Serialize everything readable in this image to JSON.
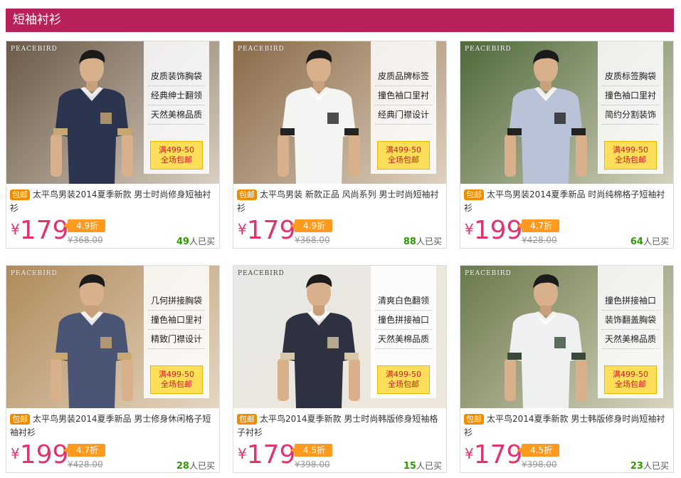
{
  "section_title": "短袖衬衫",
  "brand": "PEACEBIRD",
  "products": [
    {
      "features": [
        "皮质装饰胸袋",
        "经典绅士翻领",
        "天然美棉品质"
      ],
      "promo_line1": "满499-50",
      "promo_line2": "全场包邮",
      "free_ship": "包邮",
      "title": "太平鸟男装2014夏季新款 男士时尚修身短袖衬衫",
      "currency": "¥",
      "price": "179",
      "discount": "4.9折",
      "original_price": "¥368.00",
      "sold_count": "49",
      "sold_suffix": "人已买",
      "colors": {
        "bg": "#6b5a4a",
        "shirt": "#2b3550",
        "accent": "#c9a770"
      }
    },
    {
      "features": [
        "皮质品牌标签",
        "撞色袖口里衬",
        "经典门襟设计"
      ],
      "promo_line1": "满499-50",
      "promo_line2": "全场包邮",
      "free_ship": "包邮",
      "title": "太平鸟男装 新款正品 风尚系列 男士时尚短袖衬衫",
      "currency": "¥",
      "price": "179",
      "discount": "4.9折",
      "original_price": "¥368.00",
      "sold_count": "88",
      "sold_suffix": "人已买",
      "colors": {
        "bg": "#8a6a48",
        "shirt": "#f4f4f2",
        "accent": "#222222"
      }
    },
    {
      "features": [
        "皮质标签胸袋",
        "撞色袖口里衬",
        "简约分割装饰"
      ],
      "promo_line1": "满499-50",
      "promo_line2": "全场包邮",
      "free_ship": "包邮",
      "title": "太平鸟男装2014夏季新品 时尚纯棉格子短袖衬衫",
      "currency": "¥",
      "price": "199",
      "discount": "4.7折",
      "original_price": "¥428.00",
      "sold_count": "64",
      "sold_suffix": "人已买",
      "colors": {
        "bg": "#4e6a3a",
        "shirt": "#b9c3d8",
        "accent": "#222222"
      }
    },
    {
      "features": [
        "几何拼接胸袋",
        "撞色袖口里衬",
        "精致门襟设计"
      ],
      "promo_line1": "满499-50",
      "promo_line2": "全场包邮",
      "free_ship": "包邮",
      "title": "太平鸟男装2014夏季新品 男士修身休闲格子短袖衬衫",
      "currency": "¥",
      "price": "199",
      "discount": "4.7折",
      "original_price": "¥428.00",
      "sold_count": "28",
      "sold_suffix": "人已买",
      "colors": {
        "bg": "#b08a5a",
        "shirt": "#4a5575",
        "accent": "#c9a770"
      }
    },
    {
      "features": [
        "清爽白色翻领",
        "撞色拼接袖口",
        "天然美棉品质"
      ],
      "promo_line1": "满499-50",
      "promo_line2": "全场包邮",
      "free_ship": "包邮",
      "title": "太平鸟2014夏季新款 男士时尚韩版修身短袖格子衬衫",
      "currency": "¥",
      "price": "179",
      "discount": "4.5折",
      "original_price": "¥398.00",
      "sold_count": "15",
      "sold_suffix": "人已买",
      "colors": {
        "bg": "#e8e8e6",
        "shirt": "#2e3140",
        "accent": "#d8c8a8"
      }
    },
    {
      "features": [
        "撞色拼接袖口",
        "装饰翻盖胸袋",
        "天然美棉品质"
      ],
      "promo_line1": "满499-50",
      "promo_line2": "全场包邮",
      "free_ship": "包邮",
      "title": "太平鸟2014夏季新款 男士韩版修身时尚短袖衬衫",
      "currency": "¥",
      "price": "179",
      "discount": "4.5折",
      "original_price": "¥398.00",
      "sold_count": "23",
      "sold_suffix": "人已买",
      "colors": {
        "bg": "#6a7a4a",
        "shirt": "#eef0f2",
        "accent": "#3a4a3a"
      }
    }
  ]
}
